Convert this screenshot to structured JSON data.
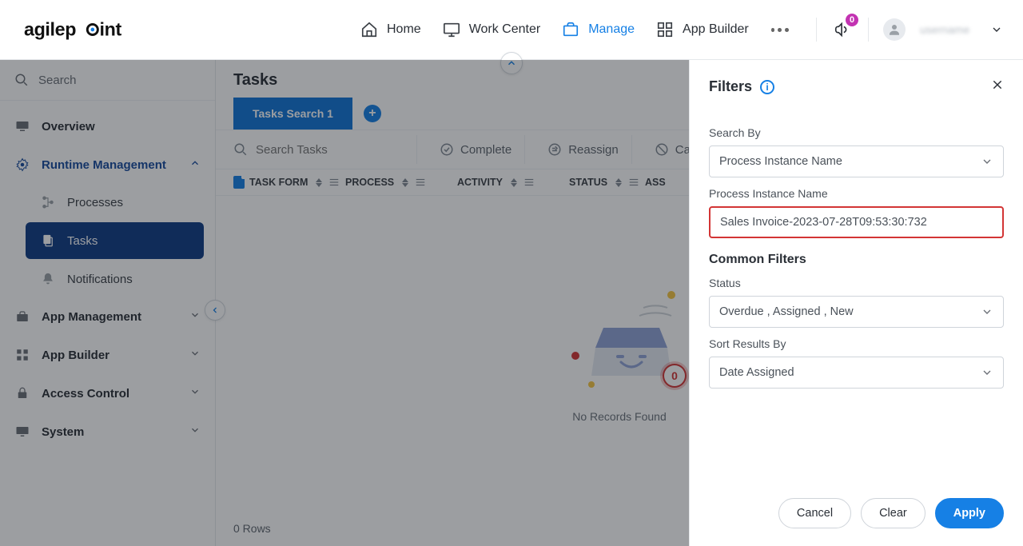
{
  "header": {
    "logo_text": "agilepoint",
    "nav": [
      {
        "key": "home",
        "label": "Home"
      },
      {
        "key": "work-center",
        "label": "Work Center"
      },
      {
        "key": "manage",
        "label": "Manage",
        "active": true
      },
      {
        "key": "app-builder",
        "label": "App Builder"
      }
    ],
    "notifications_count": "0",
    "username_placeholder": "username"
  },
  "sidebar": {
    "search_placeholder": "Search",
    "items": [
      {
        "key": "overview",
        "label": "Overview",
        "icon": "monitor-icon"
      },
      {
        "key": "runtime-mgmt",
        "label": "Runtime Management",
        "icon": "gear-icon",
        "expanded": true,
        "children": [
          {
            "key": "processes",
            "label": "Processes",
            "icon": "flow-icon"
          },
          {
            "key": "tasks",
            "label": "Tasks",
            "icon": "copy-icon",
            "active": true
          },
          {
            "key": "notifications",
            "label": "Notifications",
            "icon": "bell-icon"
          }
        ]
      },
      {
        "key": "app-management",
        "label": "App Management",
        "icon": "briefcase-icon"
      },
      {
        "key": "app-builder",
        "label": "App Builder",
        "icon": "grid-icon"
      },
      {
        "key": "access-control",
        "label": "Access Control",
        "icon": "lock-icon"
      },
      {
        "key": "system",
        "label": "System",
        "icon": "desktop-icon"
      }
    ]
  },
  "main": {
    "title": "Tasks",
    "tab_label": "Tasks Search 1",
    "search_placeholder": "Search Tasks",
    "actions": [
      {
        "key": "complete",
        "label": "Complete"
      },
      {
        "key": "reassign",
        "label": "Reassign"
      },
      {
        "key": "cancel",
        "label": "Cancel"
      }
    ],
    "columns": [
      "TASK FORM",
      "PROCESS",
      "ACTIVITY",
      "STATUS",
      "ASS"
    ],
    "empty_text": "No Records Found",
    "footer_rows": "0 Rows",
    "empty_badge": "0"
  },
  "filters": {
    "header": "Filters",
    "search_by_label": "Search By",
    "search_by_value": "Process Instance Name",
    "process_instance_label": "Process Instance Name",
    "process_instance_value": "Sales Invoice-2023-07-28T09:53:30:732",
    "common_filters_title": "Common Filters",
    "status_label": "Status",
    "status_value": "Overdue , Assigned , New",
    "sort_label": "Sort Results By",
    "sort_value": "Date Assigned",
    "cancel": "Cancel",
    "clear": "Clear",
    "apply": "Apply"
  }
}
